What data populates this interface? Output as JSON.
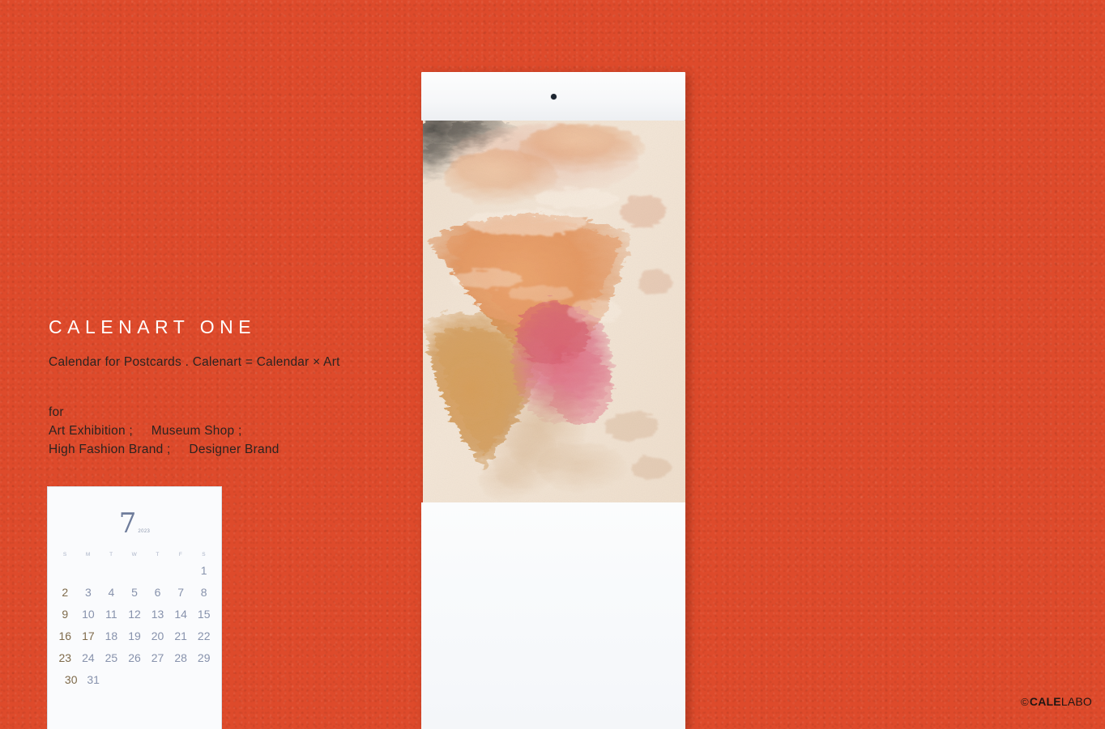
{
  "background": {
    "color": "#DE4A2B"
  },
  "branding": {
    "title": "CALENART ONE",
    "tagline": "Calendar for Postcards . Calenart = Calendar × Art",
    "audience_label": "for",
    "audience_lines": [
      "Art Exhibition ;     Museum Shop ;",
      "High Fashion Brand ;     Designer Brand"
    ]
  },
  "calendar": {
    "month_number": "7",
    "year": "2023",
    "weekday_headers": [
      "S",
      "M",
      "T",
      "W",
      "T",
      "F",
      "S"
    ],
    "weeks": [
      [
        "",
        "",
        "",
        "",
        "",
        "",
        "1"
      ],
      [
        "2",
        "3",
        "4",
        "5",
        "6",
        "7",
        "8"
      ],
      [
        "9",
        "10",
        "11",
        "12",
        "13",
        "14",
        "15"
      ],
      [
        "16",
        "17",
        "18",
        "19",
        "20",
        "21",
        "22"
      ],
      [
        "23",
        "24",
        "25",
        "26",
        "27",
        "28",
        "29"
      ],
      [
        "30",
        "31",
        "",
        "",
        "",
        "",
        ""
      ]
    ],
    "sunday_color": "#7E6A4A",
    "weekday_color": "#8792AC",
    "holiday_dates": [
      "17"
    ],
    "month_color": "#6E7C9B"
  },
  "artwork": {
    "description": "abstract oil painting, orange and pink brushwork on cream canvas",
    "palette": {
      "canvas": "#F2E4D6",
      "orange": "#E08A4E",
      "amber": "#D08B3C",
      "pink": "#D8536E",
      "charcoal": "#3B3A38",
      "cream": "#EFDECB"
    }
  },
  "logo": {
    "copyright": "©",
    "primary": "CALE",
    "secondary": "LABO"
  }
}
